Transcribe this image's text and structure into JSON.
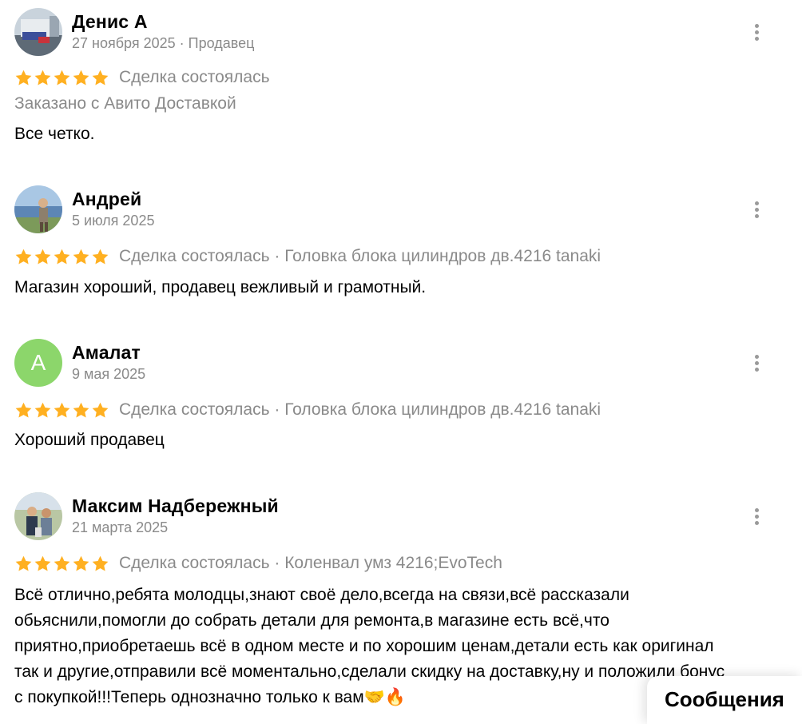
{
  "reviews": [
    {
      "author": "Денис А",
      "meta": "27 ноября 2025 · Продавец",
      "rating": 5,
      "deal": "Сделка состоялась",
      "delivery": "Заказано с Авито Доставкой",
      "text": "Все четко.",
      "avatar_icon": "photo-avatar"
    },
    {
      "author": "Андрей",
      "meta": "5 июля 2025",
      "rating": 5,
      "deal": "Сделка состоялась · Головка блока цилиндров дв.4216 tanaki",
      "text": "Магазин хороший, продавец вежливый и грамотный.",
      "avatar_icon": "photo-avatar"
    },
    {
      "author": "Амалат",
      "meta": "9 мая 2025",
      "rating": 5,
      "deal": "Сделка состоялась · Головка блока цилиндров дв.4216 tanaki",
      "text": "Хороший продавец",
      "avatar_letter": "А",
      "avatar_color": "#8cd66b"
    },
    {
      "author": "Максим Надбережный",
      "meta": "21 марта 2025",
      "rating": 5,
      "deal": "Сделка состоялась · Коленвал умз 4216;EvoTech",
      "text": "Всё отлично,ребята молодцы,знают своё дело,всегда на связи,всё рассказали обьяснили,помогли до собрать детали для ремонта,в магазине есть всё,что приятно,приобретаешь всё в одном месте и по хорошим ценам,детали есть как оригинал так и другие,отправили всё моментально,сделали скидку на доставку,ну и положили бонус с покупкой!!!Теперь однозначно только к вам🤝🔥",
      "avatar_icon": "photo-avatar"
    }
  ],
  "messages_label": "Сообщения",
  "colors": {
    "star": "#ffb021",
    "muted_text": "#8a8a8a",
    "avatar_green": "#8cd66b"
  }
}
